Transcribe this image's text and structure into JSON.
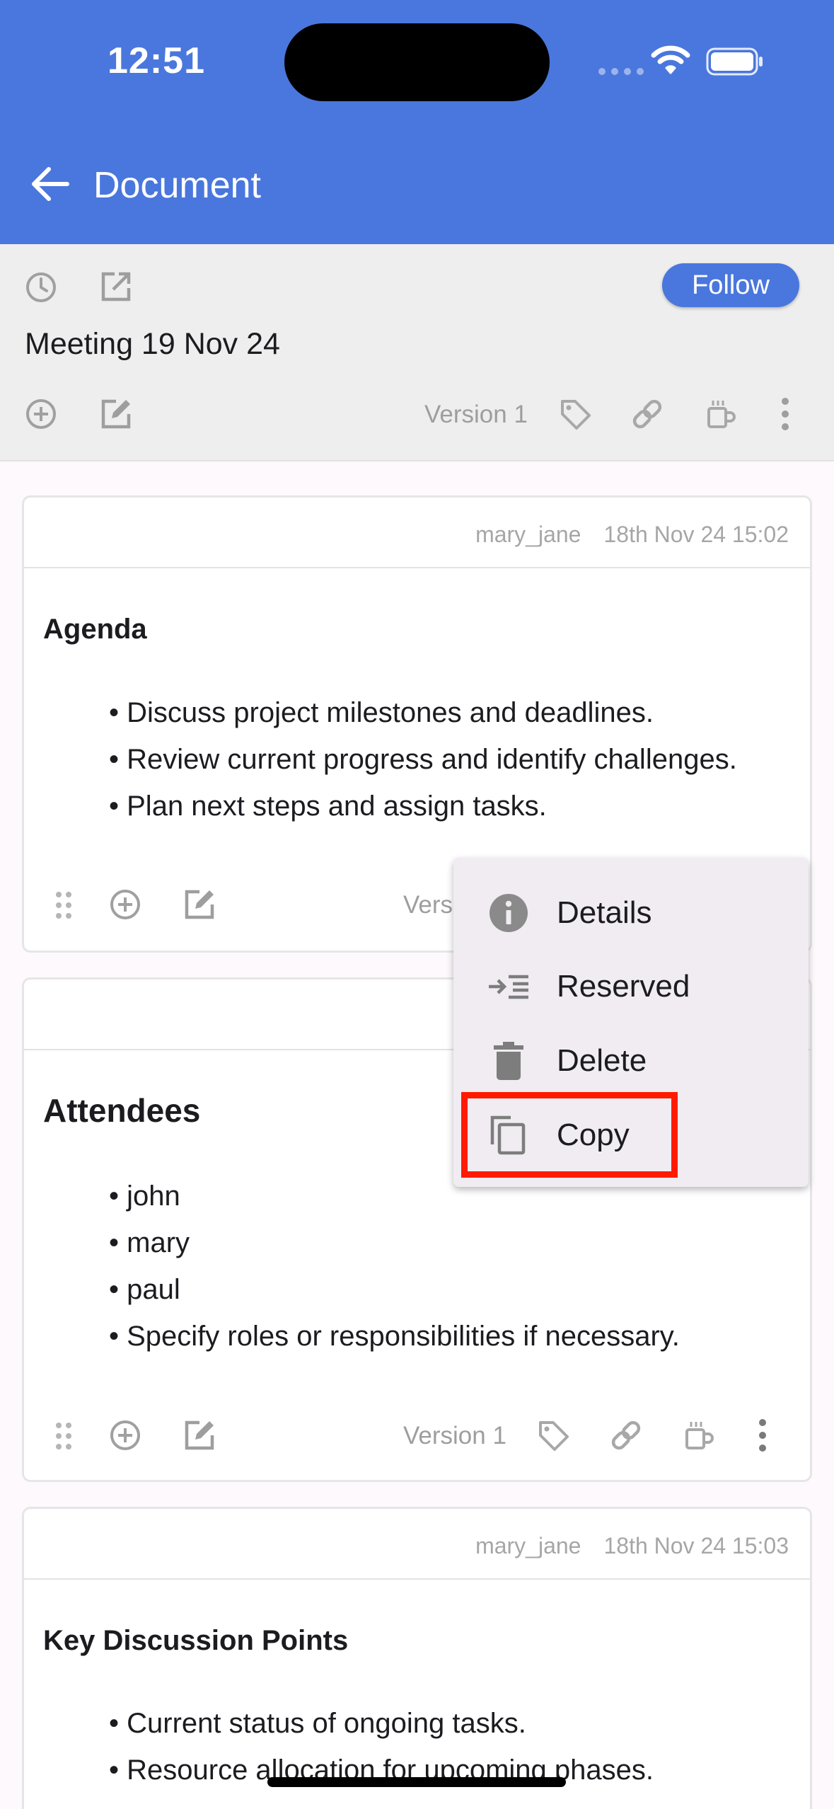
{
  "status_bar": {
    "time": "12:51"
  },
  "app_bar": {
    "title": "Document"
  },
  "doc_header": {
    "follow_label": "Follow",
    "title": "Meeting 19 Nov 24",
    "version": "Version 1"
  },
  "cards": [
    {
      "author": "mary_jane",
      "timestamp": "18th Nov 24 15:02",
      "heading": "Agenda",
      "bullets": [
        "Discuss project milestones and deadlines.",
        "Review current progress and identify challenges.",
        "Plan next steps and assign tasks."
      ],
      "version": "Vers"
    },
    {
      "heading": "Attendees",
      "bullets": [
        "john",
        "mary",
        "paul",
        "Specify roles or responsibilities if necessary."
      ],
      "version": "Version 1"
    },
    {
      "author": "mary_jane",
      "timestamp": "18th Nov 24 15:03",
      "heading": "Key Discussion Points",
      "bullets": [
        "Current status of ongoing tasks.",
        "Resource allocation for upcoming phases."
      ]
    }
  ],
  "menu": {
    "items": [
      {
        "label": "Details",
        "icon": "info-icon"
      },
      {
        "label": "Reserved",
        "icon": "indent-icon"
      },
      {
        "label": "Delete",
        "icon": "trash-icon"
      },
      {
        "label": "Copy",
        "icon": "copy-icon"
      }
    ],
    "highlighted": "Copy"
  },
  "colors": {
    "primary": "#4a77dd",
    "highlight_border": "#ff1a00",
    "menu_bg": "#f0ecf1",
    "icon_gray": "#9e9e9e"
  }
}
